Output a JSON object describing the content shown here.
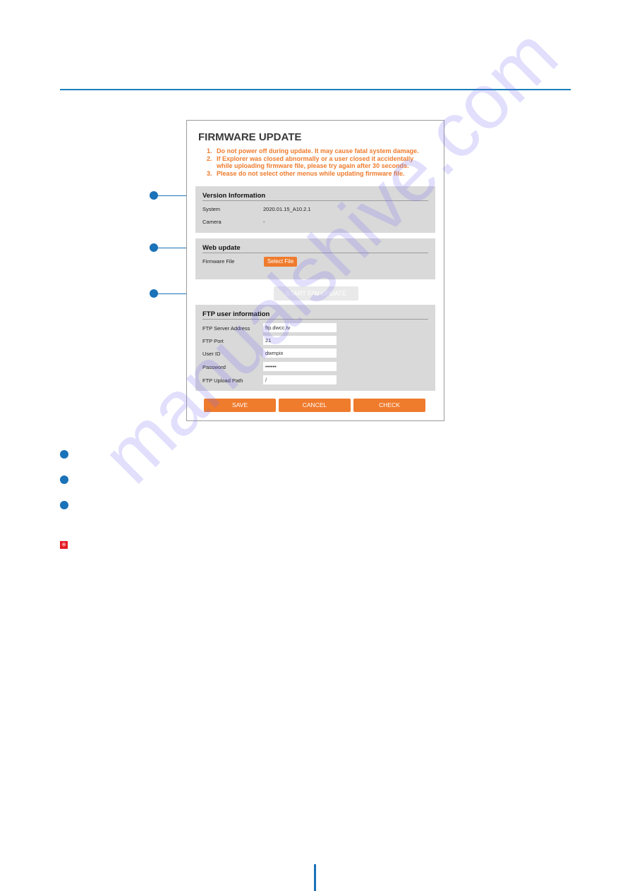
{
  "panel": {
    "title": "FIRMWARE UPDATE",
    "warnings": [
      {
        "num": "1.",
        "text": "Do not power off during update. It may cause fatal system damage."
      },
      {
        "num": "2.",
        "text": "If Explorer was closed abnormally or a user closed it accidentally while uploading firmware file, please try again after 30 seconds."
      },
      {
        "num": "3.",
        "text": "Please do not select other menus while updating firmware file."
      }
    ],
    "version_info": {
      "title": "Version Information",
      "rows": [
        {
          "label": "System",
          "value": "2020.01.15_A10.2.1"
        },
        {
          "label": "Camera",
          "value": "-"
        }
      ]
    },
    "web_update": {
      "title": "Web update",
      "firmware_file_label": "Firmware File",
      "select_file_label": "Select File"
    },
    "start_button_label": "START F/W UPDATE",
    "ftp": {
      "title": "FTP user information",
      "fields": [
        {
          "label": "FTP Server Address",
          "value": "ftp.dwcc.tv"
        },
        {
          "label": "FTP Port",
          "value": "21"
        },
        {
          "label": "User ID",
          "value": "dwmpix"
        },
        {
          "label": "Password",
          "value": "••••••"
        },
        {
          "label": "FTP Upload Path",
          "value": "/"
        }
      ]
    },
    "buttons": {
      "save": "SAVE",
      "cancel": "CANCEL",
      "check": "CHECK"
    }
  },
  "note_icon_glyph": "※",
  "watermark": "manualshive.com",
  "colors": {
    "accent_blue": "#1a72b8",
    "orange": "#ef7b2d",
    "section_gray": "#d9d9d9"
  }
}
